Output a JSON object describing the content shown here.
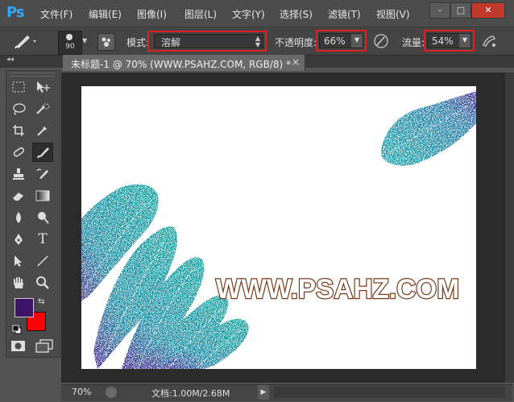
{
  "app": {
    "logo": "Ps"
  },
  "menu": [
    "文件(F)",
    "编辑(E)",
    "图像(I)",
    "图层(L)",
    "文字(Y)",
    "选择(S)",
    "滤镜(T)",
    "视图(V)"
  ],
  "window_controls": {
    "minimize": "–",
    "maximize": "□",
    "close": "✕"
  },
  "options": {
    "brush_size": "90",
    "mode_label": "模式:",
    "mode_value": "溶解",
    "opacity_label": "不透明度:",
    "opacity_value": "66%",
    "flow_label": "流量:",
    "flow_value": "54%"
  },
  "document": {
    "tab_title": "未标题-1 @ 70% (WWW.PSAHZ.COM, RGB/8) *",
    "close": "×",
    "canvas_text": "WWW.PSAHZ.COM"
  },
  "colors": {
    "foreground": "#3d1466",
    "background": "#ff0000",
    "highlight": "#e02020",
    "teal": "#14a4a0",
    "purple": "#4a2890"
  },
  "tools": [
    "marquee-icon",
    "move-icon",
    "lasso-icon",
    "quick-select-icon",
    "crop-icon",
    "eyedropper-icon",
    "healing-icon",
    "brush-icon",
    "stamp-icon",
    "history-brush-icon",
    "eraser-icon",
    "gradient-icon",
    "blur-icon",
    "dodge-icon",
    "pen-icon",
    "type-icon",
    "path-select-icon",
    "line-icon",
    "hand-icon",
    "zoom-icon"
  ],
  "tool_glyphs": {
    "type": "T"
  },
  "status": {
    "zoom": "70%",
    "doc_info": "文档:1.00M/2.68M"
  }
}
